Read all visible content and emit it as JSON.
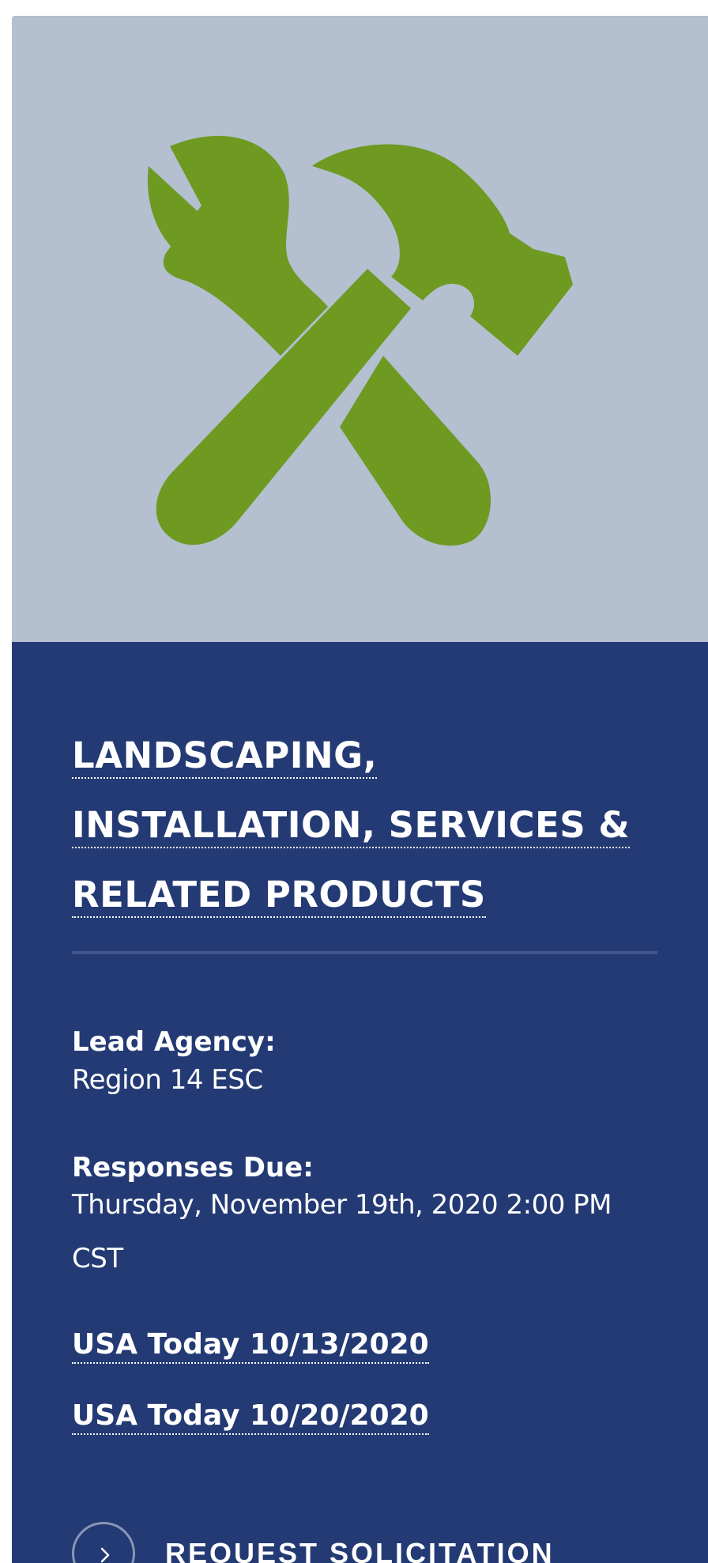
{
  "card": {
    "icon": "hammer-wrench-icon",
    "colors": {
      "image_background": "#b4bfcf",
      "icon_green": "#6e9a22",
      "panel_background": "#243a74"
    },
    "title_lines": [
      "LANDSCAPING,",
      "INSTALLATION, SERVICES &",
      "RELATED PRODUCTS"
    ],
    "lead_agency_label": "Lead Agency:",
    "lead_agency_value": "Region 14 ESC",
    "responses_due_label": "Responses Due:",
    "responses_due_line1": "Thursday, November 19th, 2020 2:00 PM",
    "responses_due_line2": "CST",
    "links": [
      "USA Today 10/13/2020",
      "USA Today 10/20/2020"
    ],
    "cta_label": "REQUEST SOLICITATION",
    "cta_icon": "chevron-right-icon"
  }
}
